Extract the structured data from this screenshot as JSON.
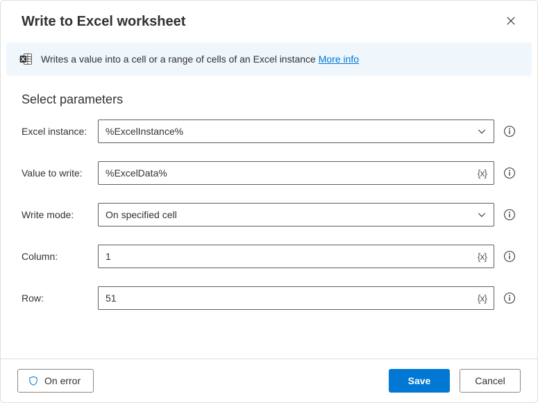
{
  "dialog": {
    "title": "Write to Excel worksheet"
  },
  "banner": {
    "text": "Writes a value into a cell or a range of cells of an Excel instance ",
    "link_text": "More info"
  },
  "params": {
    "section_title": "Select parameters",
    "excel_instance": {
      "label": "Excel instance:",
      "value": "%ExcelInstance%"
    },
    "value_to_write": {
      "label": "Value to write:",
      "value": "%ExcelData%"
    },
    "write_mode": {
      "label": "Write mode:",
      "value": "On specified cell"
    },
    "column": {
      "label": "Column:",
      "value": "1"
    },
    "row": {
      "label": "Row:",
      "value": "51"
    }
  },
  "footer": {
    "on_error": "On error",
    "save": "Save",
    "cancel": "Cancel"
  }
}
